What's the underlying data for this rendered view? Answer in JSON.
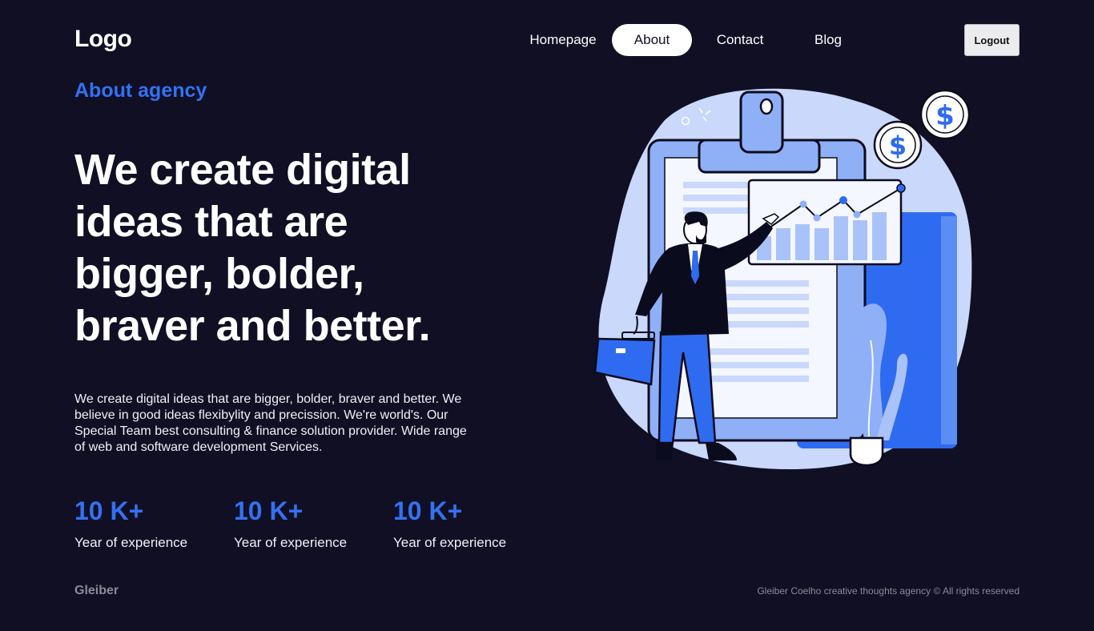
{
  "header": {
    "logo": "Logo",
    "nav": [
      "Homepage",
      "About",
      "Contact",
      "Blog"
    ],
    "active_nav": "About",
    "logout": "Logout"
  },
  "hero": {
    "eyebrow": "About agency",
    "headline_lines": [
      "We create digital",
      "ideas that are",
      "bigger, bolder,",
      "braver and better."
    ],
    "description_lines": [
      "We create digital ideas that are bigger, bolder, braver and better. We",
      "believe in good ideas flexibylity and precission. We're world's. Our",
      "Special Team best consulting & finance solution provider. Wide range",
      "of web and software development Services."
    ]
  },
  "stats": [
    {
      "value": "10 K+",
      "label": "Year of experience"
    },
    {
      "value": "10 K+",
      "label": "Year of experience"
    },
    {
      "value": "10 K+",
      "label": "Year of experience"
    }
  ],
  "footer": {
    "brand": "Gleiber",
    "copyright": "Gleiber Coelho creative thoughts agency © All rights reserved"
  },
  "illustration": {
    "subject": "businessman-presenting-growth-chart",
    "coin_symbol": "$"
  },
  "colors": {
    "background": "#100f24",
    "accent": "#3371f2",
    "light_blue": "#c9d8fb",
    "mid_blue": "#8fb0f7",
    "muted_text": "#8b8b96"
  }
}
